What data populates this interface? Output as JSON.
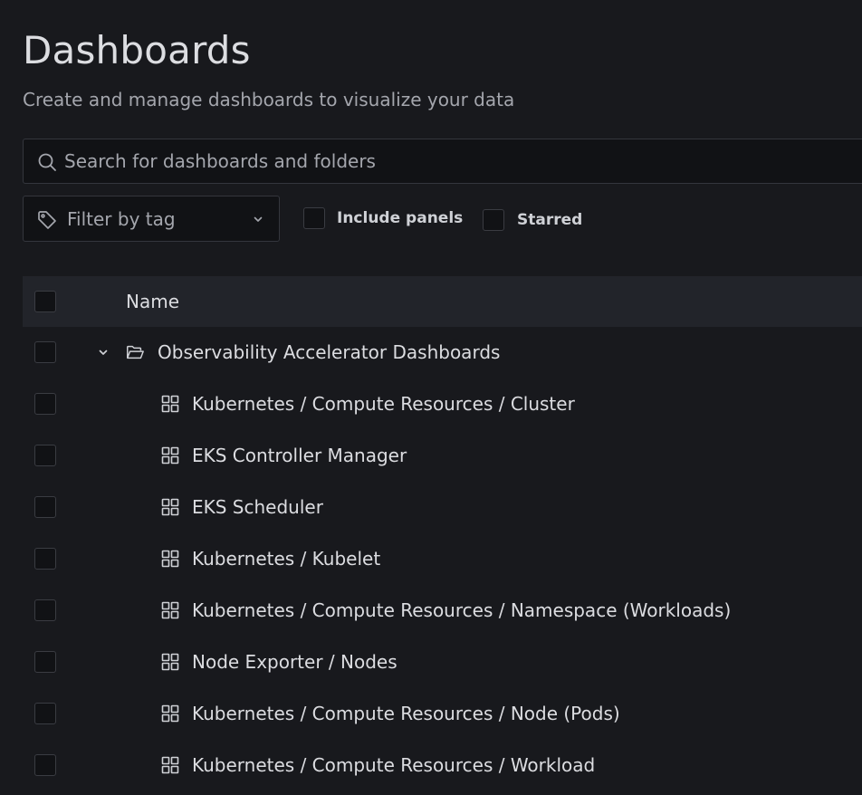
{
  "page": {
    "title": "Dashboards",
    "subtitle": "Create and manage dashboards to visualize your data"
  },
  "search": {
    "placeholder": "Search for dashboards and folders",
    "value": "",
    "icon": "search-icon"
  },
  "filters": {
    "tag_placeholder": "Filter by tag",
    "tag_icon": "tag-icon",
    "include_panels_label": "Include panels",
    "include_panels_checked": false,
    "starred_label": "Starred",
    "starred_checked": false
  },
  "table": {
    "header_name": "Name",
    "folder": {
      "name": "Observability Accelerator Dashboards",
      "expanded": true,
      "icon": "folder-open-icon"
    },
    "dashboards": [
      {
        "title": "Kubernetes / Compute Resources / Cluster",
        "icon": "dashboard-grid-icon"
      },
      {
        "title": "EKS Controller Manager",
        "icon": "dashboard-grid-icon"
      },
      {
        "title": "EKS Scheduler",
        "icon": "dashboard-grid-icon"
      },
      {
        "title": "Kubernetes / Kubelet",
        "icon": "dashboard-grid-icon"
      },
      {
        "title": "Kubernetes / Compute Resources / Namespace (Workloads)",
        "icon": "dashboard-grid-icon"
      },
      {
        "title": "Node Exporter / Nodes",
        "icon": "dashboard-grid-icon"
      },
      {
        "title": "Kubernetes / Compute Resources / Node (Pods)",
        "icon": "dashboard-grid-icon"
      },
      {
        "title": "Kubernetes / Compute Resources / Workload",
        "icon": "dashboard-grid-icon"
      }
    ]
  },
  "colors": {
    "background": "#18191d",
    "header_row": "#22242a",
    "input_bg": "#111215",
    "border": "#34363d",
    "text_primary": "#dcdde1",
    "text_secondary": "#a4a6ad"
  }
}
